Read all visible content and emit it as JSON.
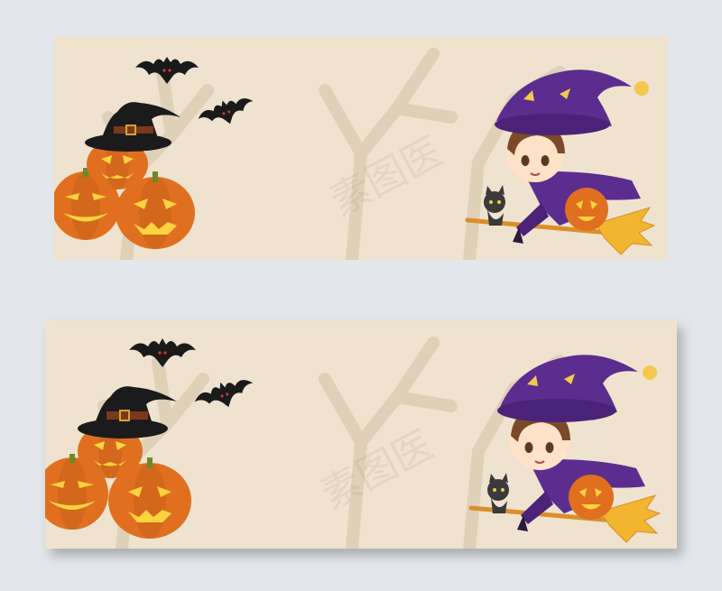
{
  "watermark": {
    "text": "素图医"
  },
  "colors": {
    "page_background": "#e3e7eb",
    "banner_background": "#efe3cf",
    "pumpkin": "#e0701f",
    "hat_purple": "#5b2d8f",
    "bat": "#1a1a1a",
    "broom": "#f2b530"
  },
  "banners": [
    {
      "id": "top",
      "icons": [
        "bat-icon",
        "bat-icon",
        "witch-hat-icon",
        "pumpkin-icon",
        "pumpkin-icon",
        "pumpkin-icon",
        "witch-girl-icon",
        "black-cat-icon",
        "broom-icon"
      ]
    },
    {
      "id": "bottom",
      "icons": [
        "bat-icon",
        "bat-icon",
        "witch-hat-icon",
        "pumpkin-icon",
        "pumpkin-icon",
        "pumpkin-icon",
        "witch-girl-icon",
        "black-cat-icon",
        "broom-icon"
      ]
    }
  ]
}
